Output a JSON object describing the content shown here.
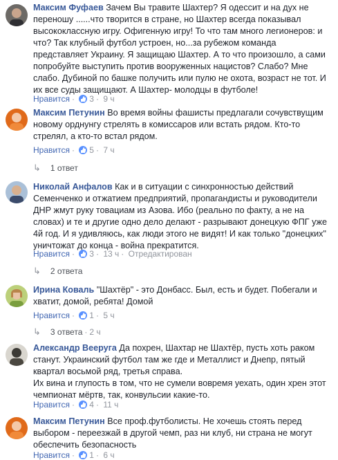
{
  "comments": [
    {
      "author": "Максим Фуфаев",
      "text": "Зачем Вы травите Шахтер? Я одессит и на дух не переношу ......что творится в стране, но Шахтер всегда показывал высококлассную игру. Офигенную игру! То что там много легионеров: и что? Так клубный футбол устроен, но...за рубежом команда представляет Украину. Я защищаю Шахтер. А то что произошло, а сами попробуйте выступить против вооруженных нацистов? Слабо? Мне слабо. Дубиной по башке получить или пулю не охота, возраст не тот. И их все суды защищают. А Шахтер- молодцы в футболе!",
      "like_label": "Нравится",
      "likes": "3",
      "time": "9 ч"
    },
    {
      "author": "Максим Петунин",
      "text": "Во время войны фашисты предлагали сочувствущим новому орднунгу стрелять в комиссаров или встать рядом. Кто-то стрелял, а кто-то встал рядом.",
      "like_label": "Нравится",
      "likes": "5",
      "time": "7 ч",
      "replies": "1 ответ"
    },
    {
      "author": "Николай Анфалов",
      "text": "Как и в ситуации с синхронностью действий Семенченко и отжатием предприятий, пропагандисты и руководители ДНР жмут руку товациам из Азова. Ибо (реально по факту, а не на словах) и те и другие одно дело делают - разрывают донецкую ФПГ уже 4й год. И я удивляюсь, как люди этого не видят! И как только \"донецких\" уничтожат до конца - война прекратится.",
      "like_label": "Нравится",
      "likes": "3",
      "time": "13 ч",
      "edited": "Отредактирован",
      "replies": "2 ответа"
    },
    {
      "author": "Ирина Коваль",
      "text": "\"Шахтёр\" - это Донбасс. Был, есть и будет. Побегали и хватит, домой, ребята! Домой",
      "like_label": "Нравится",
      "likes": "1",
      "time": "5 ч",
      "replies": "3 ответа",
      "replies_time": "2 ч"
    },
    {
      "author": "Александр Вееруга",
      "text": "Да похрен, Шахтар не Шахтёр, пусть хоть раком станут. Украинский футбол там же где и Металлист и Днепр, пятый квартал восьмой ряд, третья справа.",
      "text2": "Их вина и глупость в том, что не сумели вовремя уехать, один хрен этот чемпионат мёртв, так, конвульсии какие-то.",
      "like_label": "Нравится",
      "likes": "4",
      "time": "11 ч"
    },
    {
      "author": "Максим Петунин",
      "text": "Все проф.футболисты. Не хочешь стоять перед выбором - переезжай в другой чемп, раз ни клуб, ни страна не могут обеспечить безопасность",
      "like_label": "Нравится",
      "likes": "1",
      "time": "6 ч"
    }
  ],
  "colors": {
    "author": "#385898",
    "like": "#4267b2",
    "meta": "#90949c",
    "badge": "#5890ff"
  }
}
